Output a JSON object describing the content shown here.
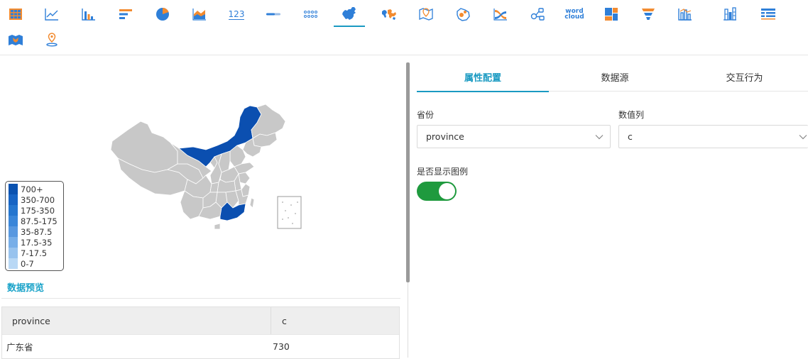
{
  "toolbar": {
    "icons": [
      "table-icon",
      "line-chart-icon",
      "bar-chart-icon",
      "horizontal-bar-icon",
      "pie-chart-icon",
      "area-chart-icon",
      "number-icon",
      "progress-bar-icon",
      "dot-matrix-icon",
      "china-map-icon",
      "world-map-icon",
      "location-map-icon",
      "bubble-map-icon",
      "sankey-icon",
      "relation-icon",
      "word-cloud-icon",
      "treemap-icon",
      "funnel-icon",
      "histogram-icon",
      "stacked-bar-icon",
      "cross-table-icon",
      "3d-map-icon",
      "geo-pin-icon"
    ],
    "number_label": "123",
    "wordcloud_label_1": "word",
    "wordcloud_label_2": "cloud",
    "active": "china-map-icon",
    "colors": {
      "blue": "#2f7fd8",
      "orange": "#f28b30",
      "teal": "#1a9ac2"
    }
  },
  "map": {
    "highlight_color": "#0b4fb0",
    "base_color": "#c8c8c8",
    "highlighted_regions": [
      "内蒙古",
      "广东省"
    ]
  },
  "legend": {
    "items": [
      {
        "label": "700+",
        "color": "#0a52b0"
      },
      {
        "label": "350-700",
        "color": "#1764c4"
      },
      {
        "label": "175-350",
        "color": "#2576cf"
      },
      {
        "label": "87.5-175",
        "color": "#3a86d9"
      },
      {
        "label": "35-87.5",
        "color": "#5898e0"
      },
      {
        "label": "17.5-35",
        "color": "#77aee8"
      },
      {
        "label": "7-17.5",
        "color": "#98c3ee"
      },
      {
        "label": "0-7",
        "color": "#b9d8f5"
      }
    ]
  },
  "preview": {
    "title": "数据预览",
    "columns": [
      "province",
      "c"
    ],
    "rows": [
      [
        "广东省",
        "730"
      ]
    ]
  },
  "tabs": [
    "属性配置",
    "数据源",
    "交互行为"
  ],
  "active_tab": "属性配置",
  "config": {
    "province_label": "省份",
    "province_value": "province",
    "value_label": "数值列",
    "value_value": "c",
    "legend_toggle_label": "是否显示图例",
    "legend_toggle_on": true,
    "toggle_color": "#1f9a3e"
  }
}
